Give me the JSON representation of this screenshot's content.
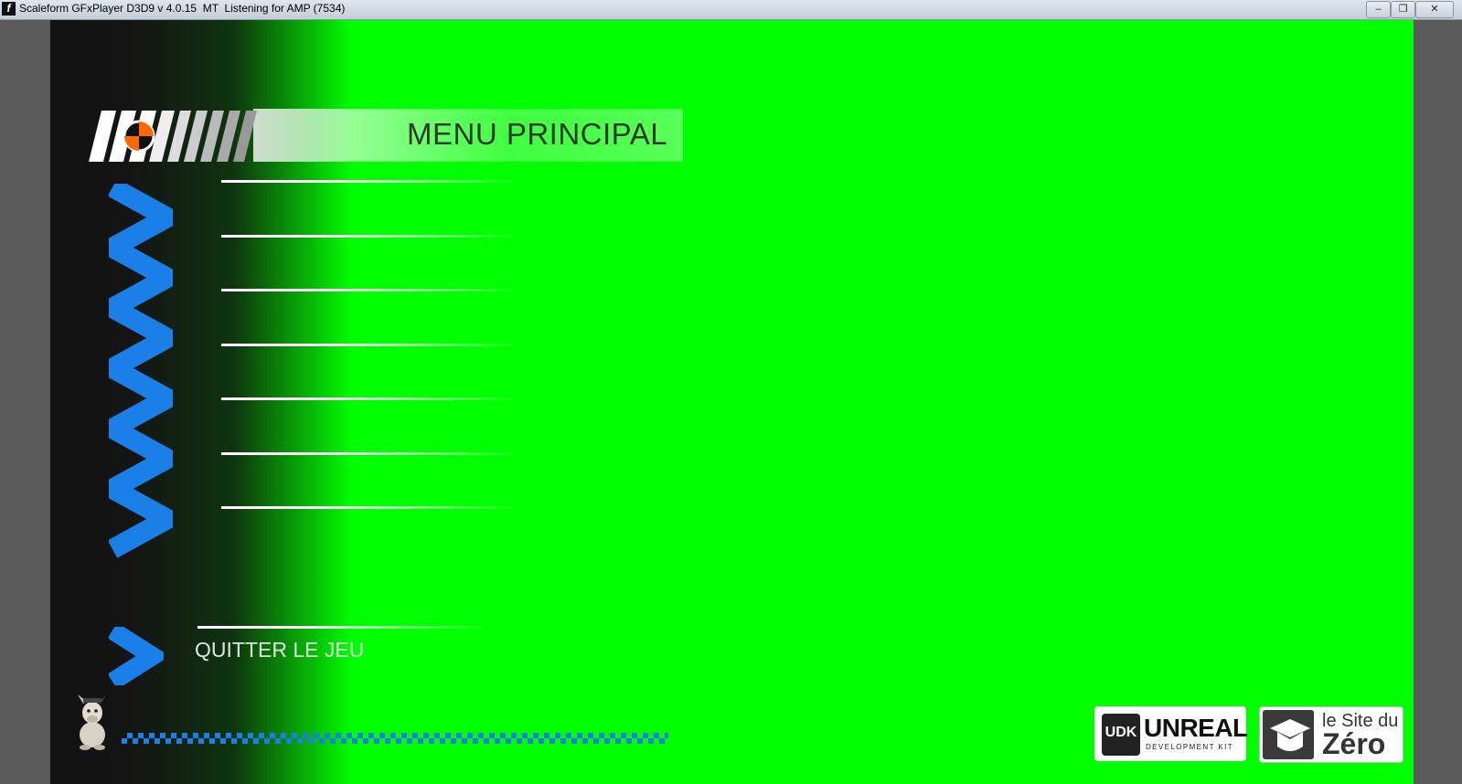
{
  "window": {
    "title": "Scaleform GFxPlayer D3D9 v 4.0.15  MT  Listening for AMP (7534)",
    "app_icon_glyph": "f",
    "minimize_glyph": "–",
    "restore_glyph": "❐",
    "close_glyph": "✕"
  },
  "menu": {
    "title": "MENU PRINCIPAL",
    "items": [
      "",
      "",
      "",
      "",
      "",
      "",
      ""
    ],
    "quit_label": "QUITTER LE JEU"
  },
  "logos": {
    "udk_badge": "UDK",
    "udk_word": "UNREAL",
    "udk_sub": "DEVELOPMENT KIT",
    "sdz_line1": "le Site du",
    "sdz_line2": "Zéro"
  },
  "colors": {
    "stage_green": "#00ff00",
    "accent_blue": "#1a7fe6",
    "orange": "#ff6a00"
  }
}
